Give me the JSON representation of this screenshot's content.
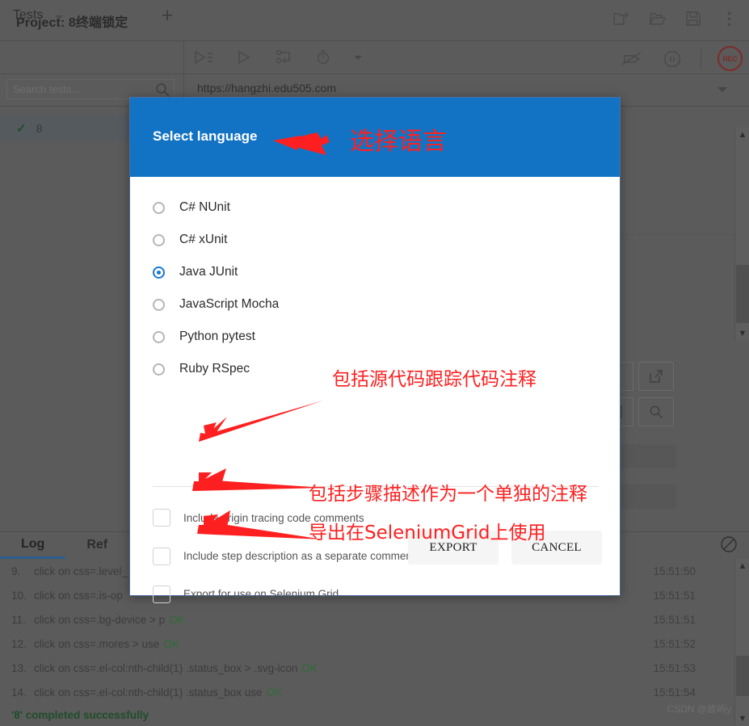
{
  "window": {
    "project_label": "Project:",
    "project_name": "8终端锁定",
    "titlebar_icons": [
      "new-project-icon",
      "open-project-icon",
      "save-project-icon",
      "more-options-icon"
    ]
  },
  "left_panel": {
    "header_label": "Tests",
    "add_button_label": "+",
    "search": {
      "placeholder": "Search tests...",
      "value": "",
      "icon": "search-icon"
    },
    "tests": [
      {
        "status": "✓",
        "name": "8"
      }
    ]
  },
  "toolbar": {
    "icons": [
      "run-all-tests-icon",
      "run-test-icon",
      "step-debug-icon",
      "speed-timer-icon"
    ],
    "right_icons": [
      "disable-breakpoints-icon",
      "pause-icon"
    ],
    "record_label": "REC"
  },
  "url_bar": {
    "value": "https://hangzhi.edu505.com",
    "dropdown_icon": "chevron-down-icon"
  },
  "right_icon_panel": {
    "icons": [
      "pause-marker-icon",
      "open-external-icon",
      "select-element-icon",
      "find-element-icon"
    ]
  },
  "modal": {
    "title": "Select language",
    "languages": [
      {
        "label": "C# NUnit",
        "selected": false
      },
      {
        "label": "C# xUnit",
        "selected": false
      },
      {
        "label": "Java JUnit",
        "selected": true
      },
      {
        "label": "JavaScript Mocha",
        "selected": false
      },
      {
        "label": "Python pytest",
        "selected": false
      },
      {
        "label": "Ruby RSpec",
        "selected": false
      }
    ],
    "options": [
      {
        "label": "Include origin tracing code comments",
        "checked": false
      },
      {
        "label": "Include step description as a separate comment",
        "checked": false
      },
      {
        "label": "Export for use on Selenium Grid",
        "checked": false
      }
    ],
    "export_label": "EXPORT",
    "cancel_label": "CANCEL",
    "header_color": "#1273c4",
    "accent_color": "#1877d2"
  },
  "annotations": {
    "color": "#fe2020",
    "items": [
      {
        "text": "选择语言"
      },
      {
        "text": "包括源代码跟踪代码注释"
      },
      {
        "text": "包括步骤描述作为一个单独的注释"
      },
      {
        "text": "导出在SeleniumGrid上使用"
      }
    ]
  },
  "log_panel": {
    "tabs": [
      {
        "label": "Log",
        "active": true
      },
      {
        "label": "Ref",
        "active": false
      }
    ],
    "clear_icon": "clear-log-icon",
    "lines": [
      {
        "num": "9.",
        "text": "click on css=.level_",
        "ok": "",
        "time": "15:51:50"
      },
      {
        "num": "10.",
        "text": "click on css=.is-op",
        "ok": "",
        "time": "15:51:51"
      },
      {
        "num": "11.",
        "text": "click on css=.bg-device > p",
        "ok": "OK",
        "time": "15:51:51"
      },
      {
        "num": "12.",
        "text": "click on css=.mores > use",
        "ok": "OK",
        "time": "15:51:52"
      },
      {
        "num": "13.",
        "text": "click on css=.el-col:nth-child(1) .status_box >  .svg-icon",
        "ok": "OK",
        "time": "15:51:53"
      },
      {
        "num": "14.",
        "text": "click on css=.el-col:nth-child(1) .status_box use",
        "ok": "OK",
        "time": "15:51:54"
      }
    ],
    "final_message": "'8' completed successfully"
  },
  "watermark": "CSDN @故屿y"
}
